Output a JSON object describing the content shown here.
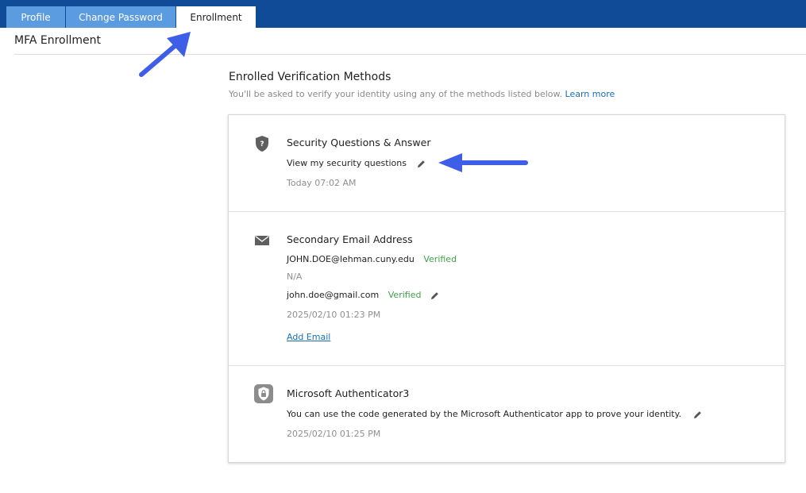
{
  "tabs": [
    {
      "label": "Profile"
    },
    {
      "label": "Change Password"
    },
    {
      "label": "Enrollment"
    }
  ],
  "page_title": "MFA Enrollment",
  "section": {
    "title": "Enrolled Verification Methods",
    "subtitle": "You'll be asked to verify your identity using any of the methods listed below.",
    "learn_more": "Learn more"
  },
  "methods": {
    "security_questions": {
      "title": "Security Questions & Answer",
      "action": "View my security questions",
      "timestamp": "Today 07:02 AM"
    },
    "email": {
      "title": "Secondary Email Address",
      "primary_email": "JOHN.DOE@lehman.cuny.edu",
      "primary_status": "Verified",
      "na": "N/A",
      "secondary_email": "john.doe@gmail.com",
      "secondary_status": "Verified",
      "timestamp": "2025/02/10 01:23 PM",
      "add_label": "Add Email"
    },
    "authenticator": {
      "title": "Microsoft Authenticator3",
      "description": "You can use the code generated by the Microsoft Authenticator app to prove your identity.",
      "timestamp": "2025/02/10 01:25 PM"
    }
  },
  "colors": {
    "topbar": "#0f4b96",
    "tab_inactive": "#5b9be0",
    "link": "#1a6fb0",
    "verified": "#3fa14a",
    "annotation_arrow": "#3f5ee8"
  }
}
